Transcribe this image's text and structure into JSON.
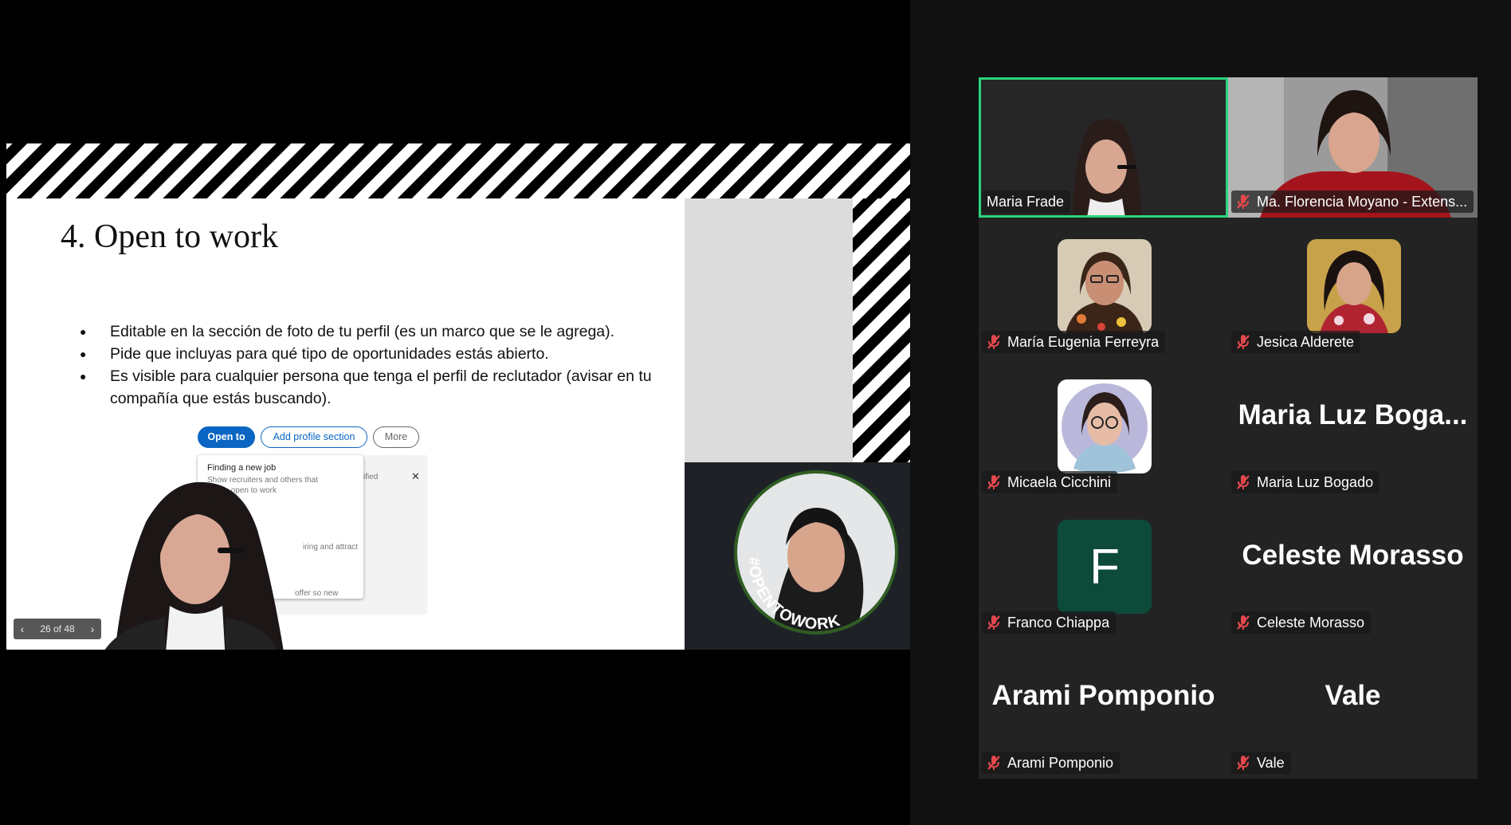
{
  "slide": {
    "title": "4. Open to work",
    "bullets": [
      "Editable en la sección de foto de tu perfil (es un marco que se le agrega).",
      "Pide que incluyas para qué tipo de oportunidades estás abierto.",
      "Es visible para cualquier persona que tenga el perfil de reclutador (avisar en tu compañía que estás buscando)."
    ],
    "linkedin": {
      "open_to": "Open to",
      "add_profile_section": "Add profile section",
      "more": "More",
      "menu_title": "Finding a new job",
      "menu_sub": "Show recruiters and others that you're open to work",
      "fragment_hiring": "iring and attract",
      "fragment_offer": "offer so new",
      "fragment_verified": "ified",
      "close": "✕"
    },
    "otw_badge": "#OPENTOWORK",
    "page_indicator": "26 of 48"
  },
  "participants": [
    {
      "name": "Maria Frade",
      "muted": false,
      "active": true,
      "display": "video"
    },
    {
      "name": "Ma. Florencia Moyano - Extens...",
      "muted": true,
      "active": false,
      "display": "video"
    },
    {
      "name": "María Eugenia Ferreyra",
      "muted": true,
      "active": false,
      "display": "avatar"
    },
    {
      "name": "Jesica Alderete",
      "muted": true,
      "active": false,
      "display": "avatar"
    },
    {
      "name": "Micaela Cicchini",
      "muted": true,
      "active": false,
      "display": "avatar"
    },
    {
      "name": "Maria Luz Bogado",
      "muted": true,
      "active": false,
      "display": "text",
      "big": "Maria Luz Boga..."
    },
    {
      "name": "Franco Chiappa",
      "muted": true,
      "active": false,
      "display": "initial",
      "initial": "F"
    },
    {
      "name": "Celeste Morasso",
      "muted": true,
      "active": false,
      "display": "text",
      "big": "Celeste Morasso"
    },
    {
      "name": "Arami Pomponio",
      "muted": true,
      "active": false,
      "display": "text",
      "big": "Arami Pomponio"
    },
    {
      "name": "Vale",
      "muted": true,
      "active": false,
      "display": "text",
      "big": "Vale"
    }
  ],
  "colors": {
    "active_border": "#2bd47d",
    "muted_mic": "#e5484d",
    "franco_avatar": "#0d4a3a"
  }
}
